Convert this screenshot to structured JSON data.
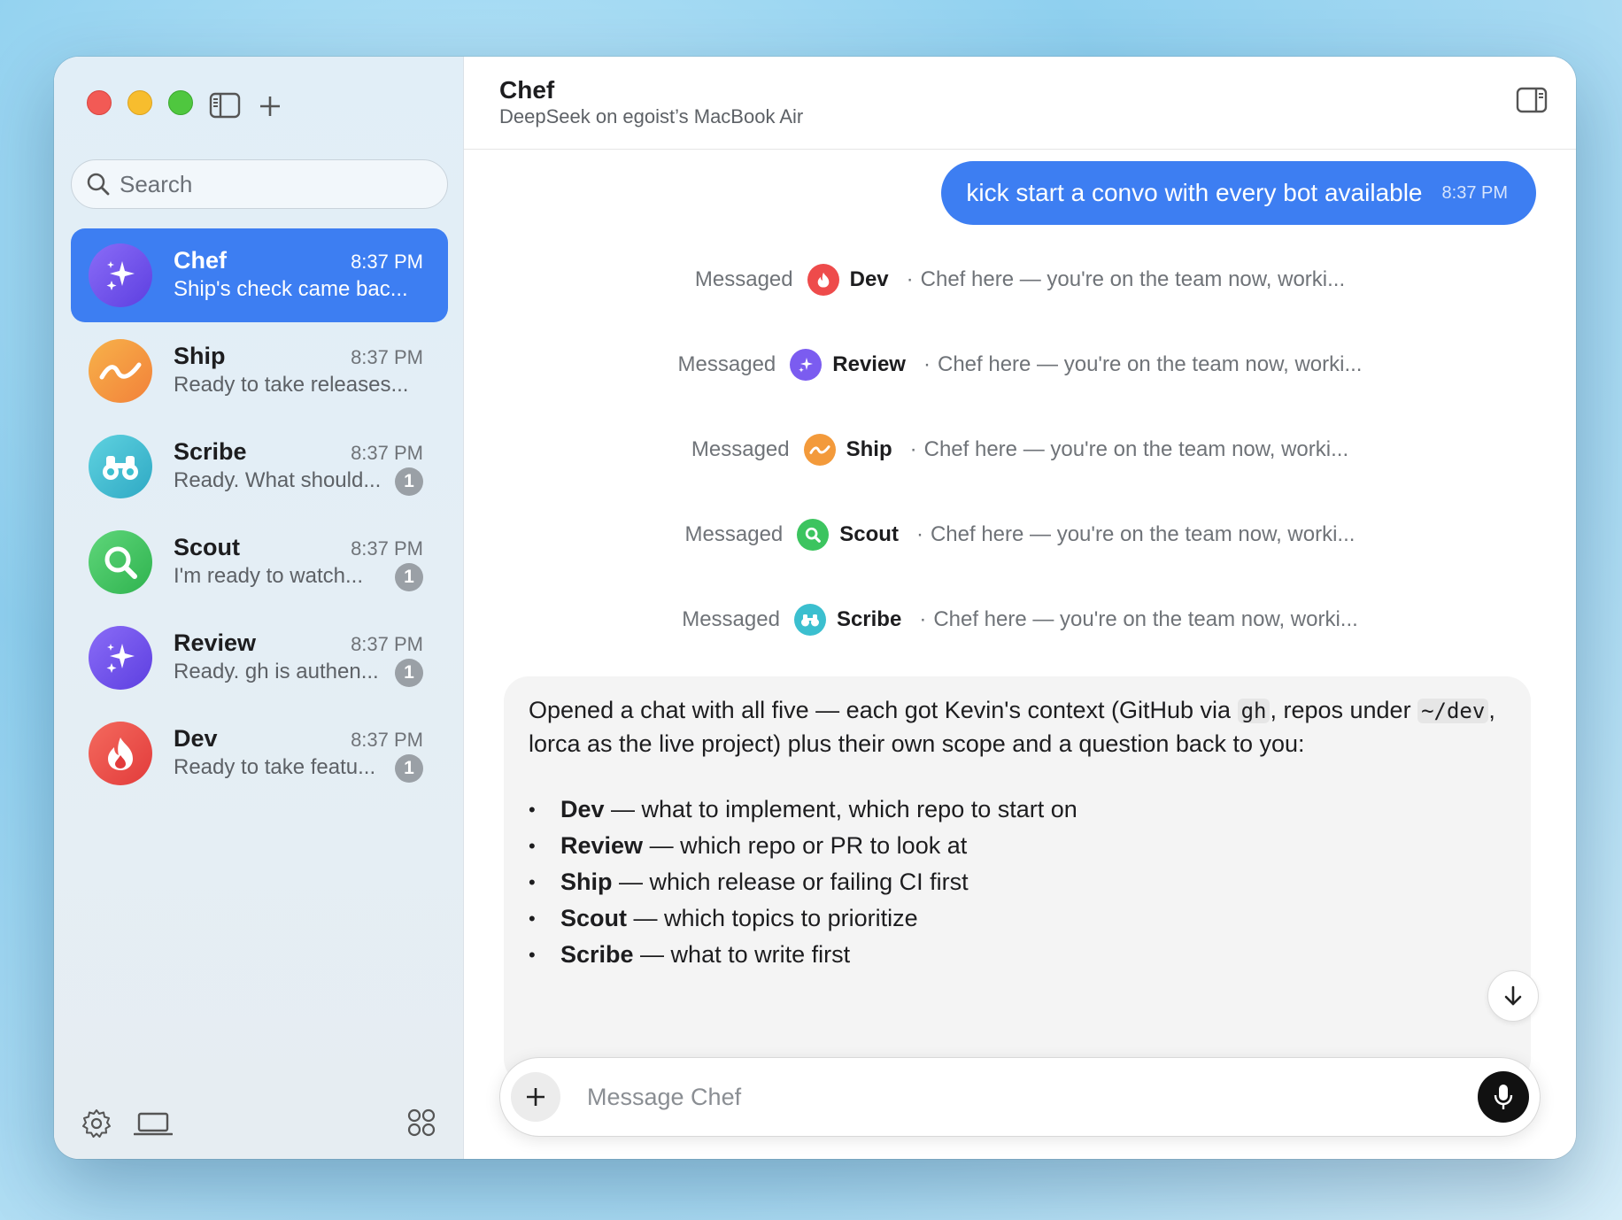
{
  "sidebar": {
    "search_placeholder": "Search",
    "chats": [
      {
        "name": "Chef",
        "time": "8:37 PM",
        "preview": "Ship's check came bac...",
        "badge": "",
        "active": true,
        "icon": "sparkles-icon",
        "color": "#7b5cf0"
      },
      {
        "name": "Ship",
        "time": "8:37 PM",
        "preview": "Ready to take releases...",
        "badge": "",
        "icon": "wave-icon",
        "color": "#f39a3b"
      },
      {
        "name": "Scribe",
        "time": "8:37 PM",
        "preview": "Ready. What should...",
        "badge": "1",
        "icon": "binoculars-icon",
        "color": "#3bbfcf"
      },
      {
        "name": "Scout",
        "time": "8:37 PM",
        "preview": "I'm ready to watch...",
        "badge": "1",
        "icon": "magnifier-icon",
        "color": "#3cc45f"
      },
      {
        "name": "Review",
        "time": "8:37 PM",
        "preview": "Ready. gh is authen...",
        "badge": "1",
        "icon": "sparkles-icon",
        "color": "#7b5cf0"
      },
      {
        "name": "Dev",
        "time": "8:37 PM",
        "preview": "Ready to take featu...",
        "badge": "1",
        "icon": "flame-icon",
        "color": "#ee4b4b"
      }
    ]
  },
  "header": {
    "title": "Chef",
    "subtitle": "DeepSeek on egoist’s MacBook Air"
  },
  "messages": {
    "user": {
      "text": "kick start a convo with every bot available",
      "time": "8:37 PM"
    },
    "events": [
      {
        "label": "Messaged",
        "bot": "Dev",
        "snippet": "Chef here — you're on the team now, worki...",
        "color": "#ee4b4b",
        "icon": "flame-icon"
      },
      {
        "label": "Messaged",
        "bot": "Review",
        "snippet": "Chef here — you're on the team now, worki...",
        "color": "#7b5cf0",
        "icon": "sparkles-icon"
      },
      {
        "label": "Messaged",
        "bot": "Ship",
        "snippet": "Chef here — you're on the team now, worki...",
        "color": "#f39a3b",
        "icon": "wave-icon"
      },
      {
        "label": "Messaged",
        "bot": "Scout",
        "snippet": "Chef here — you're on the team now, worki...",
        "color": "#3cc45f",
        "icon": "magnifier-icon"
      },
      {
        "label": "Messaged",
        "bot": "Scribe",
        "snippet": "Chef here — you're on the team now, worki...",
        "color": "#3bbfcf",
        "icon": "binoculars-icon"
      }
    ],
    "assistant": {
      "p1": "Opened a chat with all five — each got Kevin's context (GitHub via ",
      "code1": "gh",
      "p2": ", repos under ",
      "code2": "~/dev",
      "p3": ", lorca as the live project) plus their own scope and a question back to you:",
      "bullets": [
        {
          "bold": "Dev",
          "rest": " — what to implement, which repo to start on"
        },
        {
          "bold": "Review",
          "rest": " — which repo or PR to look at"
        },
        {
          "bold": "Ship",
          "rest": " — which release or failing CI first"
        },
        {
          "bold": "Scout",
          "rest": " — which topics to prioritize"
        },
        {
          "bold": "Scribe",
          "rest": " — what to write first"
        }
      ]
    }
  },
  "composer": {
    "placeholder": "Message Chef"
  },
  "colors": {
    "accent": "#3d7ef2"
  }
}
